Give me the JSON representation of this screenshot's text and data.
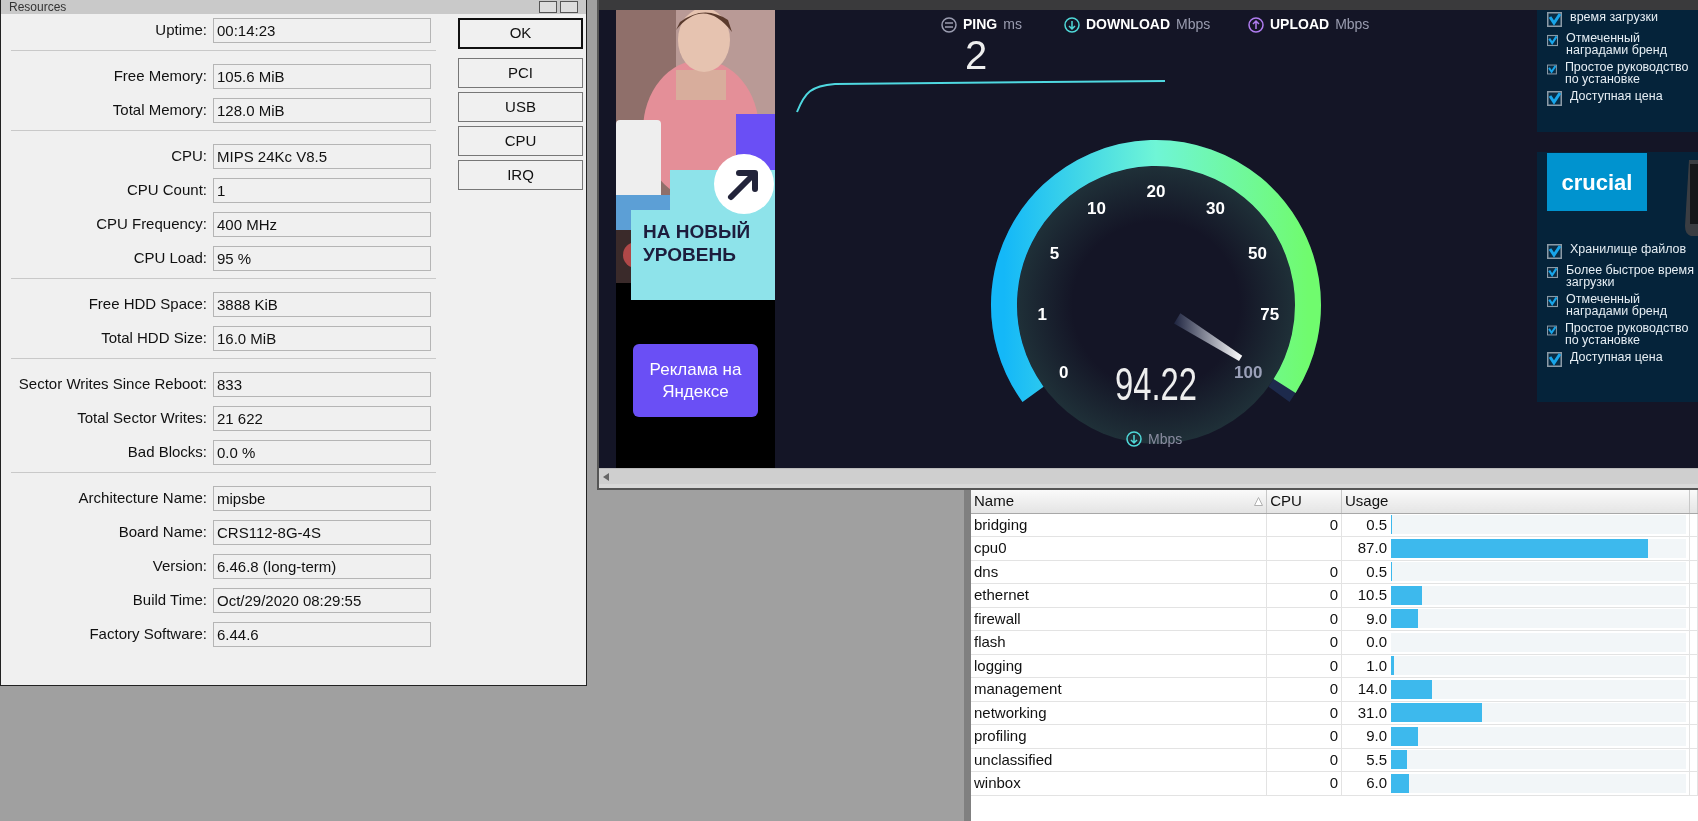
{
  "resources_window": {
    "title": "Resources",
    "groups": [
      [
        {
          "label": "Uptime:",
          "value": "00:14:23"
        }
      ],
      [
        {
          "label": "Free Memory:",
          "value": "105.6 MiB"
        },
        {
          "label": "Total Memory:",
          "value": "128.0 MiB"
        }
      ],
      [
        {
          "label": "CPU:",
          "value": "MIPS 24Kc V8.5"
        },
        {
          "label": "CPU Count:",
          "value": "1"
        },
        {
          "label": "CPU Frequency:",
          "value": "400 MHz"
        },
        {
          "label": "CPU Load:",
          "value": "95 %"
        }
      ],
      [
        {
          "label": "Free HDD Space:",
          "value": "3888 KiB"
        },
        {
          "label": "Total HDD Size:",
          "value": "16.0 MiB"
        }
      ],
      [
        {
          "label": "Sector Writes Since Reboot:",
          "value": "833"
        },
        {
          "label": "Total Sector Writes:",
          "value": "21 622"
        },
        {
          "label": "Bad Blocks:",
          "value": "0.0 %"
        }
      ],
      [
        {
          "label": "Architecture Name:",
          "value": "mipsbe"
        },
        {
          "label": "Board Name:",
          "value": "CRS112-8G-4S"
        },
        {
          "label": "Version:",
          "value": "6.46.8 (long-term)"
        },
        {
          "label": "Build Time:",
          "value": "Oct/29/2020 08:29:55"
        },
        {
          "label": "Factory Software:",
          "value": "6.44.6"
        }
      ]
    ],
    "buttons": [
      {
        "label": "OK",
        "default": true
      },
      {
        "label": "PCI",
        "default": false
      },
      {
        "label": "USB",
        "default": false
      },
      {
        "label": "CPU",
        "default": false
      },
      {
        "label": "IRQ",
        "default": false
      }
    ]
  },
  "left_ad": {
    "headline": "НА НОВЫЙ УРОВЕНЬ",
    "button": "Реклама на Яндексе"
  },
  "speedtest": {
    "metrics": [
      {
        "kind": "ping",
        "label": "PING",
        "unit": "ms"
      },
      {
        "kind": "download",
        "label": "DOWNLOAD",
        "unit": "Mbps"
      },
      {
        "kind": "upload",
        "label": "UPLOAD",
        "unit": "Mbps"
      }
    ],
    "ping_value": "2",
    "gauge": {
      "ticks": [
        "0",
        "1",
        "5",
        "10",
        "20",
        "30",
        "50",
        "75",
        "100"
      ],
      "level": 0.985,
      "reading": "94.22",
      "unit": "Mbps"
    }
  },
  "right_ad": {
    "panels": [
      {
        "items": [
          {
            "text": "время загрузки",
            "checked": true
          },
          {
            "text": "Отмеченный наградами бренд",
            "checked": true
          },
          {
            "text": "Простое руководство по установке",
            "checked": true
          },
          {
            "text": "Доступная цена",
            "checked": true
          }
        ]
      },
      {
        "logo": "crucial",
        "items": [
          {
            "text": "Хранилище файлов",
            "checked": true
          },
          {
            "text": "Более быстрое время загрузки",
            "checked": true
          },
          {
            "text": "Отмеченный наградами бренд",
            "checked": true
          },
          {
            "text": "Простое руководство по установке",
            "checked": true
          },
          {
            "text": "Доступная цена",
            "checked": true
          }
        ]
      }
    ]
  },
  "process_table": {
    "columns": [
      {
        "label": "Name",
        "sorted": true
      },
      {
        "label": "CPU",
        "sorted": false
      },
      {
        "label": "Usage",
        "sorted": false
      }
    ],
    "rows": [
      {
        "name": "bridging",
        "cpu": "0",
        "usage": "0.5",
        "level": 0.005
      },
      {
        "name": "cpu0",
        "usage": "87.0",
        "level": 0.87
      },
      {
        "name": "dns",
        "cpu": "0",
        "usage": "0.5",
        "level": 0.005
      },
      {
        "name": "ethernet",
        "cpu": "0",
        "usage": "10.5",
        "level": 0.105
      },
      {
        "name": "firewall",
        "cpu": "0",
        "usage": "9.0",
        "level": 0.09
      },
      {
        "name": "flash",
        "cpu": "0",
        "usage": "0.0"
      },
      {
        "name": "logging",
        "cpu": "0",
        "usage": "1.0",
        "level": 0.01
      },
      {
        "name": "management",
        "cpu": "0",
        "usage": "14.0",
        "level": 0.14
      },
      {
        "name": "networking",
        "cpu": "0",
        "usage": "31.0",
        "level": 0.31
      },
      {
        "name": "profiling",
        "cpu": "0",
        "usage": "9.0",
        "level": 0.09
      },
      {
        "name": "unclassified",
        "cpu": "0",
        "usage": "5.5",
        "level": 0.055
      },
      {
        "name": "winbox",
        "cpu": "0",
        "usage": "6.0",
        "level": 0.06
      }
    ]
  }
}
